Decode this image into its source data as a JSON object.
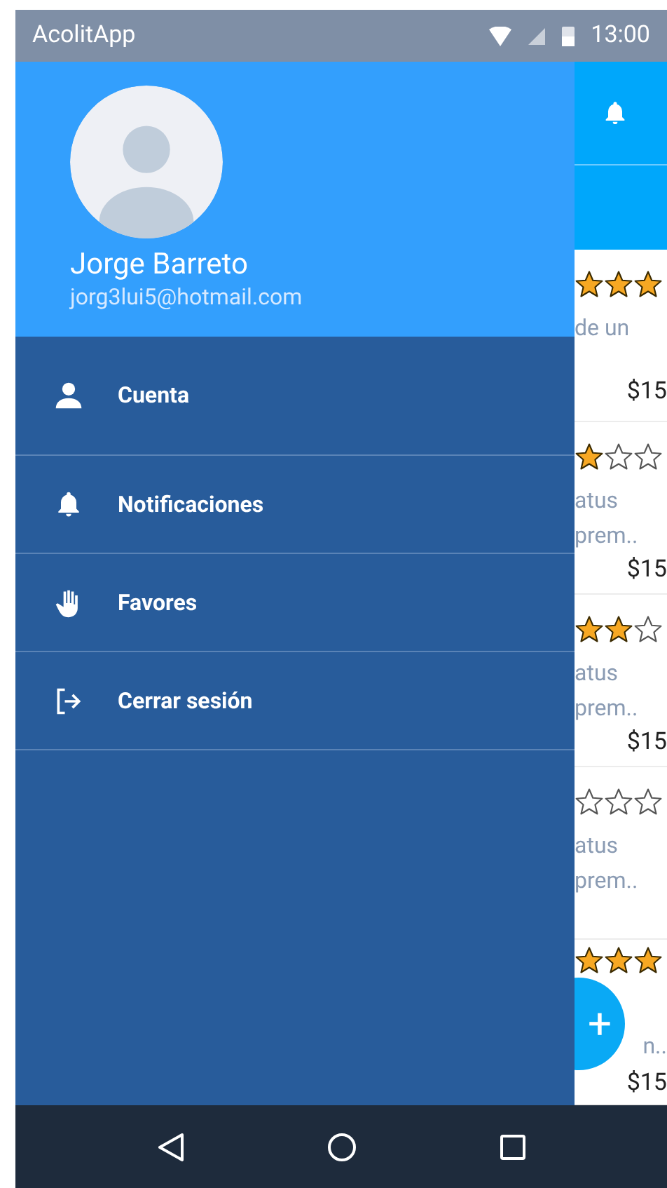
{
  "status_bar": {
    "app_name": "AcolitApp",
    "time": "13:00"
  },
  "drawer": {
    "user": {
      "name": "Jorge Barreto",
      "email": "jorg3lui5@hotmail.com"
    },
    "items": [
      {
        "kind": "account",
        "label": "Cuenta"
      },
      {
        "kind": "notifications",
        "label": "Notificaciones"
      },
      {
        "kind": "favors",
        "label": "Favores"
      },
      {
        "kind": "logout",
        "label": "Cerrar sesión"
      }
    ]
  },
  "background_list": {
    "cards": [
      {
        "stars": 3,
        "lines": [
          "de un"
        ],
        "price": "$15"
      },
      {
        "stars": 1,
        "lines": [
          "atus",
          "prem.."
        ],
        "price": "$15"
      },
      {
        "stars": 2,
        "lines": [
          "atus",
          "prem.."
        ],
        "price": "$15"
      },
      {
        "stars": 0,
        "lines": [
          "atus",
          "prem.."
        ]
      },
      {
        "stars": 3,
        "lines": [
          "n.."
        ],
        "price": "$15"
      }
    ]
  },
  "fab": {
    "label": "+"
  }
}
